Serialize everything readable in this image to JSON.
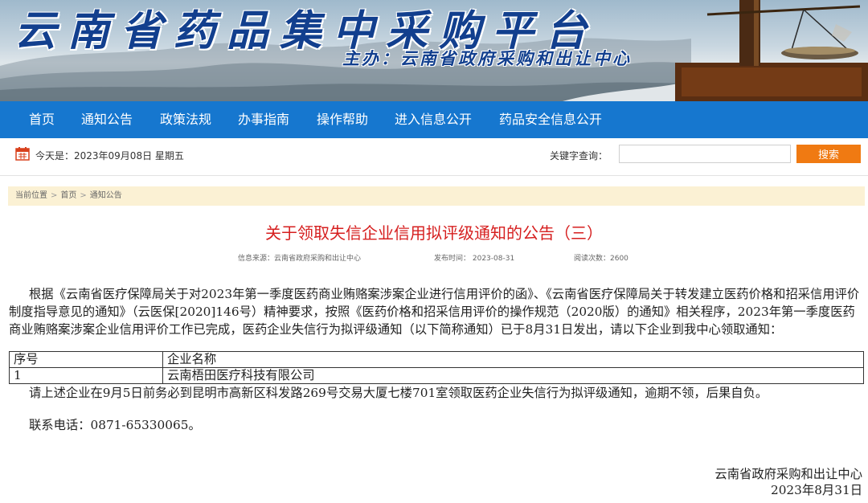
{
  "header": {
    "site_title": "云南省药品集中采购平台",
    "sponsor": "主办：云南省政府采购和出让中心"
  },
  "nav": {
    "items": [
      {
        "label": "首页"
      },
      {
        "label": "通知公告"
      },
      {
        "label": "政策法规"
      },
      {
        "label": "办事指南"
      },
      {
        "label": "操作帮助"
      },
      {
        "label": "进入信息公开"
      },
      {
        "label": "药品安全信息公开"
      }
    ]
  },
  "datebar": {
    "today": "今天是：2023年09月08日 星期五",
    "keyword_label": "关键字查询：",
    "keyword_value": "",
    "search_label": "搜索"
  },
  "breadcrumb": {
    "current": "当前位置",
    "home": "首页",
    "section": "通知公告"
  },
  "article": {
    "title": "关于领取失信企业信用拟评级通知的公告（三）",
    "source": "信息来源：云南省政府采购和出让中心",
    "date": "发布时间： 2023-08-31",
    "views": "阅读次数：2600",
    "para1": "根据《云南省医疗保障局关于对2023年第一季度医药商业贿赂案涉案企业进行信用评价的函》、《云南省医疗保障局关于转发建立医药价格和招采信用评价制度指导意见的通知》（云医保[2020]146号）精神要求，按照《医药价格和招采信用评价的操作规范（2020版）的通知》相关程序，2023年第一季度医药商业贿赂案涉案企业信用评价工作已完成，医药企业失信行为拟评级通知（以下简称通知）已于8月31日发出，请以下企业到我中心领取通知：",
    "table": {
      "headers": [
        "序号",
        "企业名称"
      ],
      "rows": [
        [
          "1",
          "云南梧田医疗科技有限公司"
        ]
      ]
    },
    "para2": "请上述企业在9月5日前务必到昆明市高新区科发路269号交易大厦七楼701室领取医药企业失信行为拟评级通知，逾期不领，后果自负。",
    "para3": "联系电话：0871-65330065。",
    "sign_org": "云南省政府采购和出让中心",
    "sign_date": "2023年8月31日"
  }
}
